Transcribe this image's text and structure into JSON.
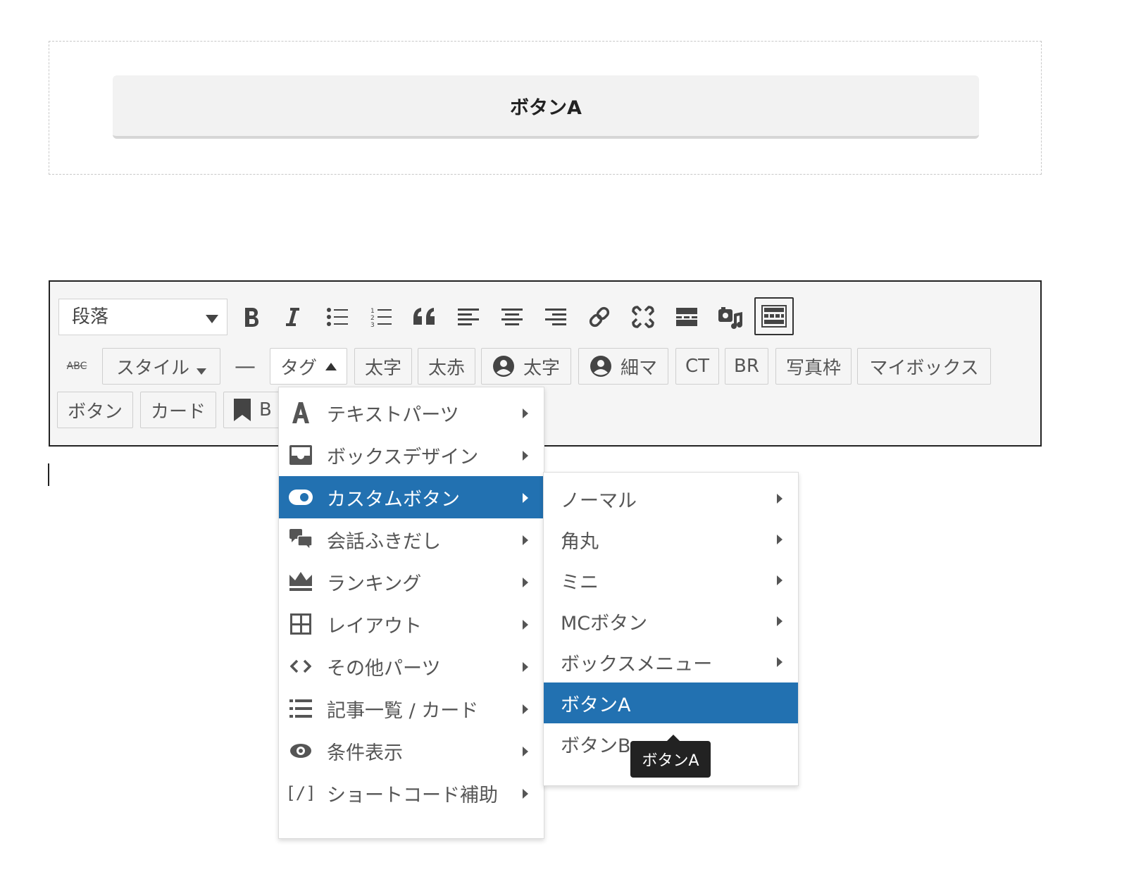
{
  "preview": {
    "button_label": "ボタンA"
  },
  "toolbar": {
    "format_select": "段落",
    "icons": [
      "bold-icon",
      "italic-icon",
      "bullet-list-icon",
      "numbered-list-icon",
      "blockquote-icon",
      "align-left-icon",
      "align-center-icon",
      "align-right-icon",
      "link-icon",
      "unlink-icon",
      "more-tag-icon",
      "media-icon",
      "toolbar-toggle-icon"
    ],
    "row2": {
      "strikethrough_label": "ABC",
      "style_label": "スタイル",
      "hr_label": "—",
      "tag_label": "タグ",
      "bold_label": "太字",
      "red_label": "太赤",
      "user_bold_label": "太字",
      "user_thin_label": "細マ",
      "ct_label": "CT",
      "br_label": "BR",
      "photo_frame_label": "写真枠",
      "mybox_label": "マイボックス"
    },
    "row3": {
      "button_label": "ボタン",
      "card_label": "カード",
      "partial_label": "B"
    }
  },
  "menu": {
    "items": [
      {
        "label": "テキストパーツ",
        "icon": "text-a-icon"
      },
      {
        "label": "ボックスデザイン",
        "icon": "inbox-icon"
      },
      {
        "label": "カスタムボタン",
        "icon": "toggle-icon"
      },
      {
        "label": "会話ふきだし",
        "icon": "comments-icon"
      },
      {
        "label": "ランキング",
        "icon": "crown-icon"
      },
      {
        "label": "レイアウト",
        "icon": "table-grid-icon"
      },
      {
        "label": "その他パーツ",
        "icon": "code-icon"
      },
      {
        "label": "記事一覧 / カード",
        "icon": "list-icon"
      },
      {
        "label": "条件表示",
        "icon": "eye-icon"
      },
      {
        "label": "ショートコード補助",
        "icon": "shortcode-icon"
      }
    ],
    "shortcode_glyph": "[/]"
  },
  "submenu": {
    "items": [
      {
        "label": "ノーマル"
      },
      {
        "label": "角丸"
      },
      {
        "label": "ミニ"
      },
      {
        "label": "MCボタン"
      },
      {
        "label": "ボックスメニュー"
      },
      {
        "label": "ボタンA"
      },
      {
        "label": "ボタンB"
      }
    ]
  },
  "tooltip": {
    "text": "ボタンA"
  },
  "colors": {
    "accent": "#2271b1",
    "tooltip_bg": "#222222"
  }
}
